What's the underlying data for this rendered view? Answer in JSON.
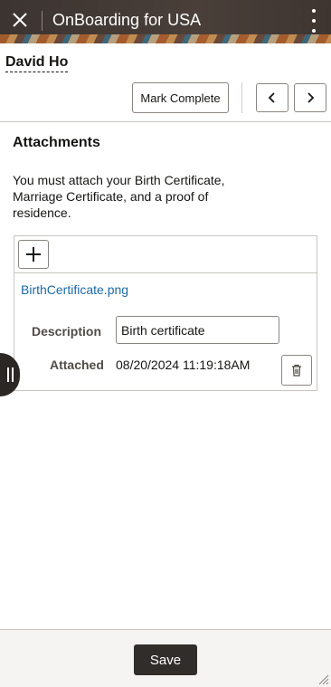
{
  "header": {
    "title": "OnBoarding for USA",
    "close_icon": "close-icon",
    "menu_icon": "more-vertical-icon"
  },
  "person": {
    "name": "David Ho"
  },
  "toolbar": {
    "mark_complete_label": "Mark Complete",
    "prev_icon": "chevron-left-icon",
    "next_icon": "chevron-right-icon"
  },
  "attachments": {
    "title": "Attachments",
    "instructions": "You must attach your Birth Certificate, Marriage Certificate, and a proof of residence.",
    "add_icon": "plus-icon",
    "items": [
      {
        "file_name": "BirthCertificate.png",
        "description_label": "Description",
        "description_value": "Birth certificate",
        "attached_label": "Attached",
        "attached_value": "08/20/2024 11:19:18AM",
        "delete_icon": "trash-icon"
      }
    ]
  },
  "footer": {
    "save_label": "Save"
  },
  "colors": {
    "header_bg": "#3b3431",
    "link": "#1b6aa6",
    "primary_button": "#312d2a",
    "footer_bg": "#f5f4f2",
    "border": "#c9c5c1"
  }
}
